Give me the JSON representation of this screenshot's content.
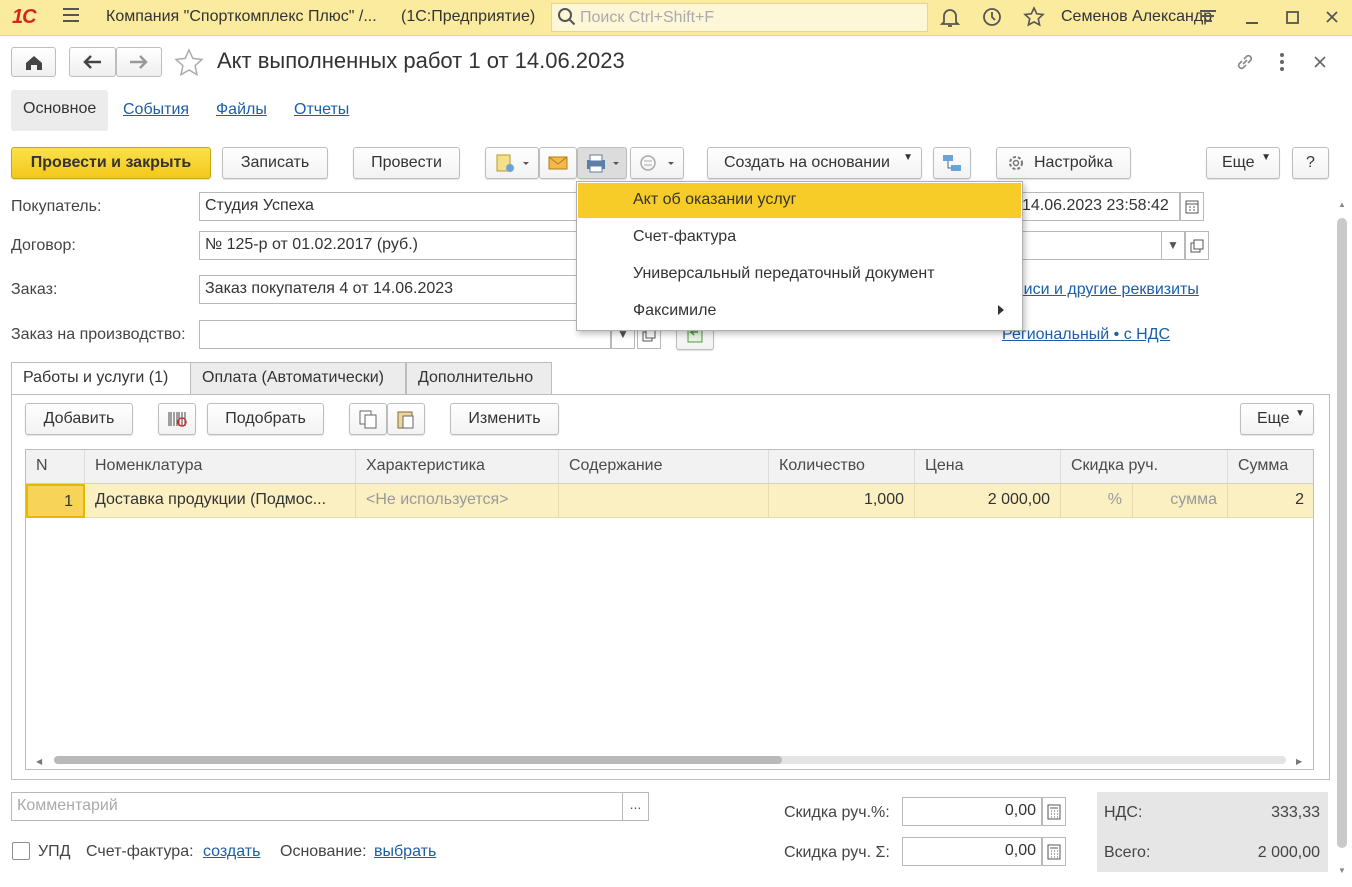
{
  "window": {
    "logo": "1С",
    "app_title": "Компания \"Спорткомплекс Плюс\" /...",
    "platform": "(1С:Предприятие)",
    "search_placeholder": "Поиск Ctrl+Shift+F",
    "user": "Семенов Александр"
  },
  "document": {
    "title": "Акт выполненных работ 1 от 14.06.2023"
  },
  "nav_tabs": [
    "Основное",
    "События",
    "Файлы",
    "Отчеты"
  ],
  "toolbar": {
    "post_and_close": "Провести и закрыть",
    "save": "Записать",
    "post": "Провести",
    "create_based_on": "Создать на основании",
    "settings": "Настройка",
    "more": "Еще",
    "help": "?"
  },
  "print_menu": {
    "items": [
      "Акт об оказании услуг",
      "Счет-фактура",
      "Универсальный передаточный документ",
      "Факсимиле"
    ]
  },
  "form": {
    "buyer_label": "Покупатель:",
    "buyer_value": "Студия Успеха",
    "contract_label": "Договор:",
    "contract_value": "№ 125-р от 01.02.2017 (руб.)",
    "order_label": "Заказ:",
    "order_value": "Заказ покупателя 4 от 14.06.2023",
    "prod_order_label": "Заказ на производство:",
    "prod_order_value": "",
    "date_value": "14.06.2023 23:58:42",
    "link_signatures": "писи и другие реквизиты",
    "link_tax": "Региональный • с НДС"
  },
  "content_tabs": [
    "Работы и услуги (1)",
    "Оплата (Автоматически)",
    "Дополнительно"
  ],
  "table_toolbar": {
    "add": "Добавить",
    "pick": "Подобрать",
    "edit": "Изменить",
    "more": "Еще"
  },
  "table": {
    "columns": [
      "N",
      "Номенклатура",
      "Характеристика",
      "Содержание",
      "Количество",
      "Цена",
      "Скидка руч.",
      "Сумма"
    ],
    "rows": [
      {
        "n": "1",
        "item": "Доставка продукции (Подмос...",
        "characteristic": "<Не используется>",
        "content": "",
        "qty": "1,000",
        "price": "2 000,00",
        "discount_pct": "%",
        "discount_sum": "сумма",
        "sum": "2"
      }
    ]
  },
  "footer": {
    "comment_placeholder": "Комментарий",
    "discount_pct_label": "Скидка руч.%:",
    "discount_pct_value": "0,00",
    "discount_sum_label": "Скидка руч. Σ:",
    "discount_sum_value": "0,00",
    "vat_label": "НДС:",
    "vat_value": "333,33",
    "total_label": "Всего:",
    "total_value": "2 000,00",
    "upd_label": "УПД",
    "invoice_label": "Счет-фактура:",
    "invoice_link": "создать",
    "basis_label": "Основание:",
    "basis_link": "выбрать"
  },
  "colors": {
    "accent_yellow": "#f7cc29",
    "titlebar": "#fbeb9e",
    "link": "#1c5fa7",
    "row_selected": "#fbf0c2"
  }
}
